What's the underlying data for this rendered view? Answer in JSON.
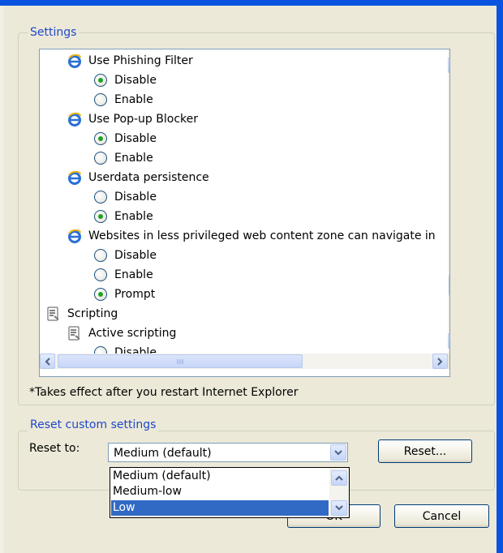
{
  "settings": {
    "group_title": "Settings",
    "rows": [
      {
        "kind": "item",
        "icon": "ie-icon",
        "label": "Use Phishing Filter"
      },
      {
        "kind": "radio",
        "label": "Disable",
        "checked": true
      },
      {
        "kind": "radio",
        "label": "Enable",
        "checked": false
      },
      {
        "kind": "item",
        "icon": "ie-icon",
        "label": "Use Pop-up Blocker"
      },
      {
        "kind": "radio",
        "label": "Disable",
        "checked": true
      },
      {
        "kind": "radio",
        "label": "Enable",
        "checked": false
      },
      {
        "kind": "item",
        "icon": "ie-icon",
        "label": "Userdata persistence"
      },
      {
        "kind": "radio",
        "label": "Disable",
        "checked": false
      },
      {
        "kind": "radio",
        "label": "Enable",
        "checked": true
      },
      {
        "kind": "item",
        "icon": "ie-icon",
        "label": "Websites in less privileged web content zone can navigate in"
      },
      {
        "kind": "radio",
        "label": "Disable",
        "checked": false
      },
      {
        "kind": "radio",
        "label": "Enable",
        "checked": false
      },
      {
        "kind": "radio",
        "label": "Prompt",
        "checked": true
      },
      {
        "kind": "category",
        "icon": "script-icon",
        "label": "Scripting"
      },
      {
        "kind": "item",
        "icon": "script-icon",
        "label": "Active scripting"
      },
      {
        "kind": "radio",
        "label": "Disable",
        "checked": false
      }
    ],
    "note": "*Takes effect after you restart Internet Explorer"
  },
  "reset": {
    "group_title": "Reset custom settings",
    "label": "Reset to:",
    "selected": "Medium (default)",
    "button_label": "Reset...",
    "options": [
      "Medium (default)",
      "Medium-low",
      "Low"
    ],
    "highlighted_option": "Low"
  },
  "footer": {
    "ok_label": "OK",
    "cancel_label": "Cancel"
  },
  "colors": {
    "group_title": "#1f47c9",
    "selection": "#316ac5",
    "radio_dot": "#21a121"
  }
}
